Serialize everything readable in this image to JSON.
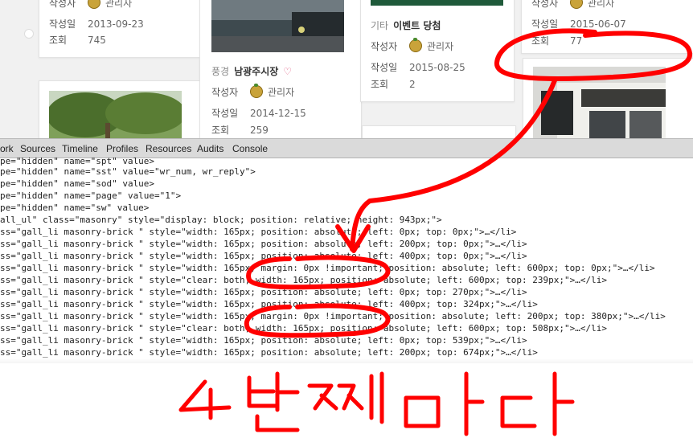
{
  "gallery": {
    "col1": {
      "author_label": "작성자",
      "author": "관리자",
      "date_label": "작성일",
      "date": "2013-09-23",
      "views_label": "조회",
      "views": "745"
    },
    "col2": {
      "category": "풍경",
      "title": "남광주시장",
      "author_label": "작성자",
      "author": "관리자",
      "date_label": "작성일",
      "date": "2014-12-15",
      "views_label": "조회",
      "views": "259"
    },
    "col3": {
      "category": "기타",
      "title": "이벤트 당첨",
      "author_label": "작성자",
      "author": "관리자",
      "date_label": "작성일",
      "date": "2015-08-25",
      "views_label": "조회",
      "views": "2"
    },
    "col4": {
      "author_label": "작성자",
      "author": "관리자",
      "date_label": "작성일",
      "date": "2015-06-07",
      "views_label": "조회",
      "views": "77"
    }
  },
  "devtools": {
    "tabs": [
      "ork",
      "Sources",
      "Timeline",
      "Profiles",
      "Resources",
      "Audits",
      "Console"
    ],
    "code_lines": [
      "pe=\"hidden\" name=\"spt\" value>",
      "pe=\"hidden\" name=\"sst\" value=\"wr_num, wr_reply\">",
      "pe=\"hidden\" name=\"sod\" value>",
      "pe=\"hidden\" name=\"page\" value=\"1\">",
      "pe=\"hidden\" name=\"sw\" value>",
      "all_ul\" class=\"masonry\" style=\"display: block; position: relative; height: 943px;\">",
      "ss=\"gall_li masonry-brick \" style=\"width: 165px; position: absolute; left: 0px; top: 0px;\">…</li>",
      "ss=\"gall_li masonry-brick \" style=\"width: 165px; position: absolute; left: 200px; top: 0px;\">…</li>",
      "ss=\"gall_li masonry-brick \" style=\"width: 165px; position: absolute; left: 400px; top: 0px;\">…</li>",
      "ss=\"gall_li masonry-brick \" style=\"width: 165px; margin: 0px !important; position: absolute; left: 600px; top: 0px;\">…</li>",
      "ss=\"gall_li masonry-brick \" style=\"clear: both; width: 165px; position: absolute; left: 600px; top: 239px;\">…</li>",
      "ss=\"gall_li masonry-brick \" style=\"width: 165px; position: absolute; left: 0px; top: 270px;\">…</li>",
      "ss=\"gall_li masonry-brick \" style=\"width: 165px; position: absolute; left: 400px; top: 324px;\">…</li>",
      "ss=\"gall_li masonry-brick \" style=\"width: 165px; margin: 0px !important; position: absolute; left: 200px; top: 380px;\">…</li>",
      "ss=\"gall_li masonry-brick \" style=\"clear: both; width: 165px; position: absolute; left: 600px; top: 508px;\">…</li>",
      "ss=\"gall_li masonry-brick \" style=\"width: 165px; position: absolute; left: 0px; top: 539px;\">…</li>",
      "ss=\"gall_li masonry-brick \" style=\"width: 165px; position: absolute; left: 200px; top: 674px;\">…</li>"
    ]
  },
  "annotation": {
    "handwriting": "4번째마다",
    "color": "#ff0000"
  }
}
